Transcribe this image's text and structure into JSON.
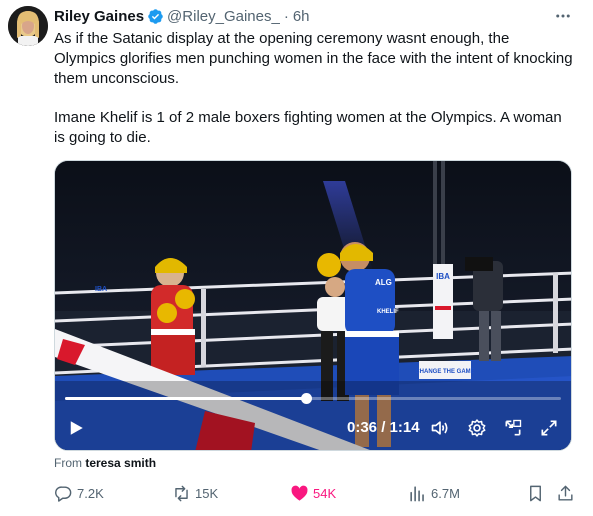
{
  "tweet": {
    "display_name": "Riley Gaines",
    "handle": "@Riley_Gaines_",
    "separator": "·",
    "time": "6h",
    "paragraph1": "As if the Satanic display at the opening ceremony wasnt enough, the Olympics glorifies men punching women in the face with the intent of knocking them unconscious.",
    "paragraph2": "Imane Khelif is 1 of 2 male boxers fighting women at the Olympics. A woman is going to die."
  },
  "video": {
    "time_display": "0:36 / 1:14",
    "progress": 0.486,
    "scene_text": {
      "ring_sponsor": "IBA",
      "corner_pad": "IBA",
      "blue_jersey_country": "ALG",
      "blue_jersey_name": "KHELIF",
      "ring_sign": "CHANGE THE GAME"
    },
    "controls": [
      "play-icon",
      "volume-icon",
      "settings-icon",
      "pip-icon",
      "fullscreen-icon"
    ]
  },
  "source": {
    "prefix": "From",
    "name": "teresa smith"
  },
  "actions": {
    "replies": "7.2K",
    "reposts": "15K",
    "likes": "54K",
    "views": "6.7M"
  },
  "colors": {
    "accent": "#1d9bf0",
    "like": "#f91880",
    "muted": "#536471",
    "ring_blue": "#1e4fc4",
    "corner_red": "#d9182c"
  }
}
